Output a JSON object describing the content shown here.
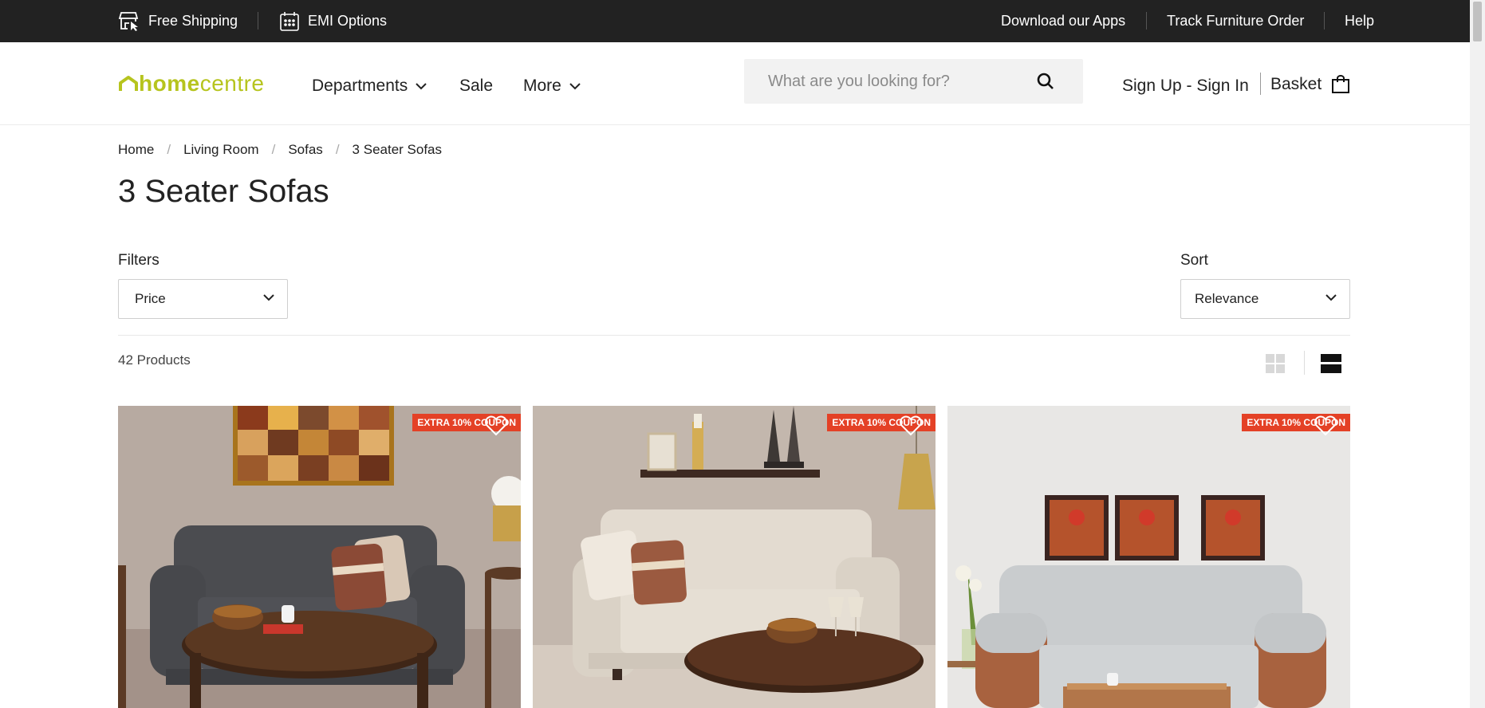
{
  "topbar": {
    "free_shipping": "Free Shipping",
    "emi_options": "EMI Options",
    "download_apps": "Download our Apps",
    "track_order": "Track Furniture Order",
    "help": "Help"
  },
  "header": {
    "logo_part1": "home",
    "logo_part2": "centre",
    "nav": {
      "departments": "Departments",
      "sale": "Sale",
      "more": "More"
    },
    "search_placeholder": "What are you looking for?",
    "signin": "Sign Up - Sign In",
    "basket": "Basket"
  },
  "breadcrumb": {
    "items": [
      "Home",
      "Living Room",
      "Sofas",
      "3 Seater Sofas"
    ],
    "separator": "/"
  },
  "page_title": "3 Seater Sofas",
  "filters": {
    "label": "Filters",
    "price": "Price"
  },
  "sort": {
    "label": "Sort",
    "value": "Relevance"
  },
  "results": {
    "count": "42 Products"
  },
  "products": [
    {
      "badge": "EXTRA 10% COUPON"
    },
    {
      "badge": "EXTRA 10% COUPON"
    },
    {
      "badge": "EXTRA 10% COUPON"
    }
  ],
  "colors": {
    "topbar_bg": "#222222",
    "brand": "#b6c41e",
    "coupon": "#e44126"
  }
}
